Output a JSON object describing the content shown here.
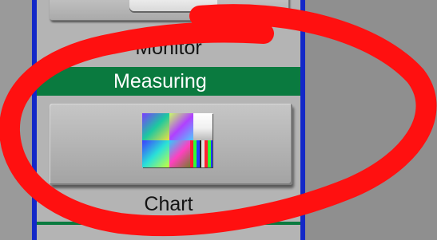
{
  "sidebar": {
    "previous_item": {
      "label": "Monitor",
      "icon": "monitor-icon"
    },
    "section": {
      "title": "Measuring",
      "color": "#0a7a3f"
    },
    "item": {
      "label": "Chart",
      "icon": "color-chart-icon"
    },
    "border_color": "#1328c8"
  },
  "annotation": {
    "type": "freehand-ellipse",
    "color": "#ff1010"
  }
}
